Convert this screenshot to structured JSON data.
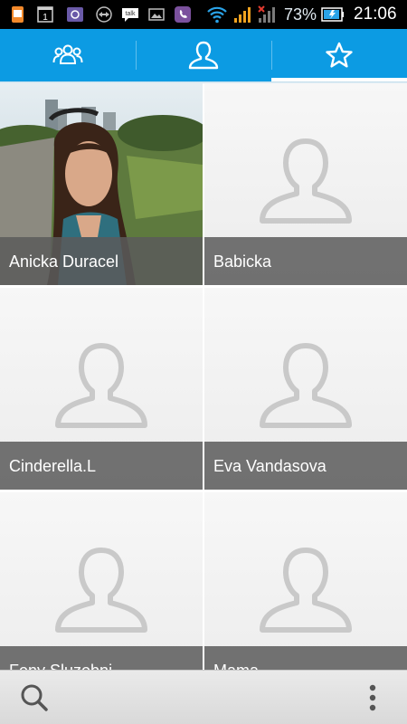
{
  "status_bar": {
    "battery_percent": "73%",
    "clock": "21:06",
    "icons": [
      "notification-icon",
      "calendar-icon",
      "camera-icon",
      "teamviewer-icon",
      "talk-icon",
      "gallery-icon",
      "viber-icon",
      "wifi-icon",
      "signal-icon",
      "signal-no-service-icon",
      "battery-icon"
    ],
    "calendar_day": "1",
    "talk_label": "talk"
  },
  "tabs": [
    {
      "name": "groups",
      "icon": "groups-icon",
      "selected": false
    },
    {
      "name": "contacts",
      "icon": "person-icon",
      "selected": false
    },
    {
      "name": "favorites",
      "icon": "star-icon",
      "selected": true
    }
  ],
  "favorites": [
    {
      "name": "Anicka Duracel",
      "has_photo": true
    },
    {
      "name": "Babicka",
      "has_photo": false
    },
    {
      "name": "Cinderella.L",
      "has_photo": false
    },
    {
      "name": "Eva Vandasova",
      "has_photo": false
    },
    {
      "name": "Fony Sluzobni",
      "has_photo": false
    },
    {
      "name": "Mama",
      "has_photo": false
    }
  ],
  "bottom_bar": {
    "left_icon": "search-icon",
    "right_icon": "overflow-menu-icon"
  },
  "colors": {
    "accent": "#0c9be3",
    "status_bar": "#000000",
    "name_bar": "#5a5a5a"
  }
}
